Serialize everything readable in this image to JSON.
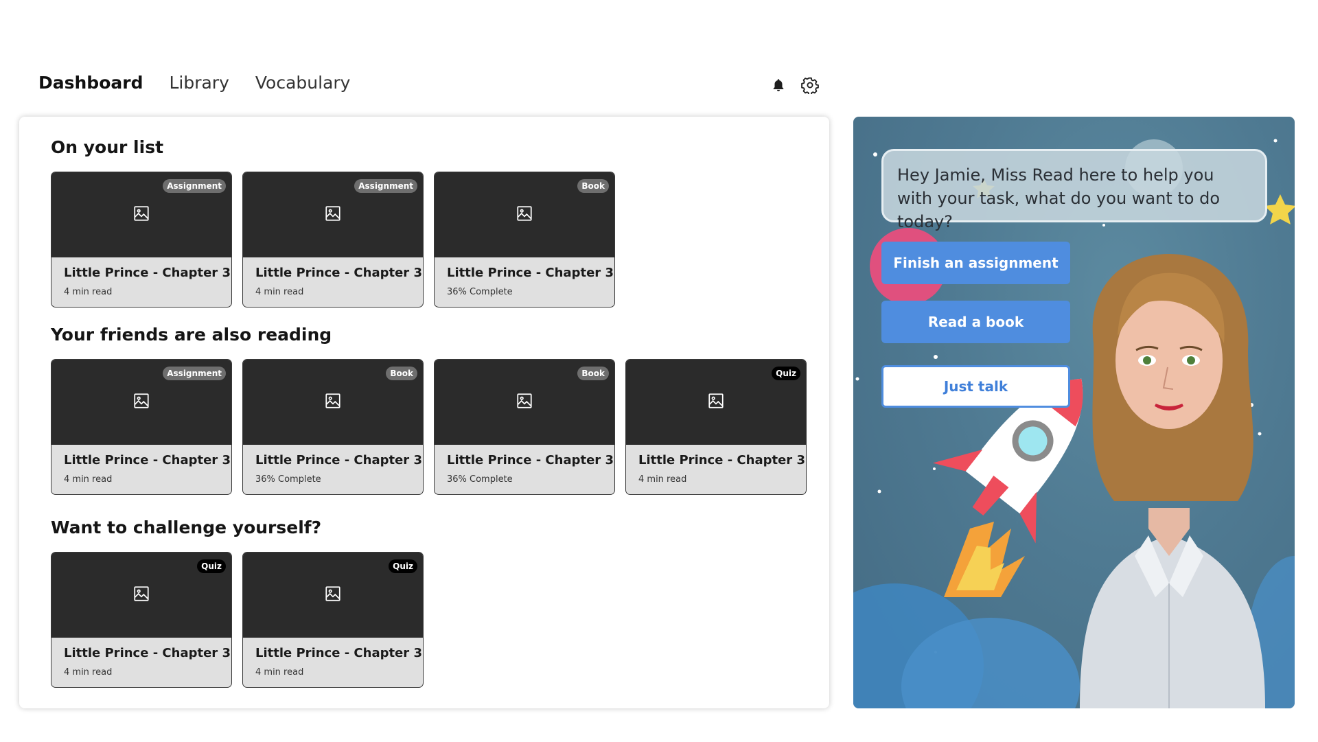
{
  "nav": {
    "items": [
      {
        "label": "Dashboard",
        "active": true
      },
      {
        "label": "Library",
        "active": false
      },
      {
        "label": "Vocabulary",
        "active": false
      }
    ],
    "icons": [
      "bell-icon",
      "gear-icon"
    ]
  },
  "sections": [
    {
      "title": "On your list",
      "cards": [
        {
          "badge": "Assignment",
          "badge_style": "grey",
          "title": "Little Prince - Chapter 3",
          "meta": "4 min read"
        },
        {
          "badge": "Assignment",
          "badge_style": "grey",
          "title": "Little Prince - Chapter 3",
          "meta": "4 min read"
        },
        {
          "badge": "Book",
          "badge_style": "grey",
          "title": "Little Prince - Chapter 3",
          "meta": "36% Complete"
        }
      ]
    },
    {
      "title": "Your friends are also reading",
      "cards": [
        {
          "badge": "Assignment",
          "badge_style": "grey",
          "title": "Little Prince - Chapter 3",
          "meta": "4 min read"
        },
        {
          "badge": "Book",
          "badge_style": "grey",
          "title": "Little Prince - Chapter 3",
          "meta": "36% Complete"
        },
        {
          "badge": "Book",
          "badge_style": "grey",
          "title": "Little Prince - Chapter 3",
          "meta": "36% Complete"
        },
        {
          "badge": "Quiz",
          "badge_style": "black",
          "title": "Little Prince - Chapter 3",
          "meta": "4 min read"
        }
      ]
    },
    {
      "title": "Want to challenge yourself?",
      "cards": [
        {
          "badge": "Quiz",
          "badge_style": "black",
          "title": "Little Prince - Chapter 3",
          "meta": "4 min read"
        },
        {
          "badge": "Quiz",
          "badge_style": "black",
          "title": "Little Prince - Chapter 3",
          "meta": "4 min read"
        }
      ]
    }
  ],
  "assistant": {
    "message": "Hey Jamie, Miss Read here to help you with your task, what do you want to do today?",
    "buttons": [
      "Finish an assignment",
      "Read a book",
      "Just talk"
    ]
  },
  "colors": {
    "accent": "#4f8ddf",
    "card_thumb": "#2b2b2b",
    "card_body": "#e0e0e0",
    "assistant_bg": "#4f7a92"
  }
}
